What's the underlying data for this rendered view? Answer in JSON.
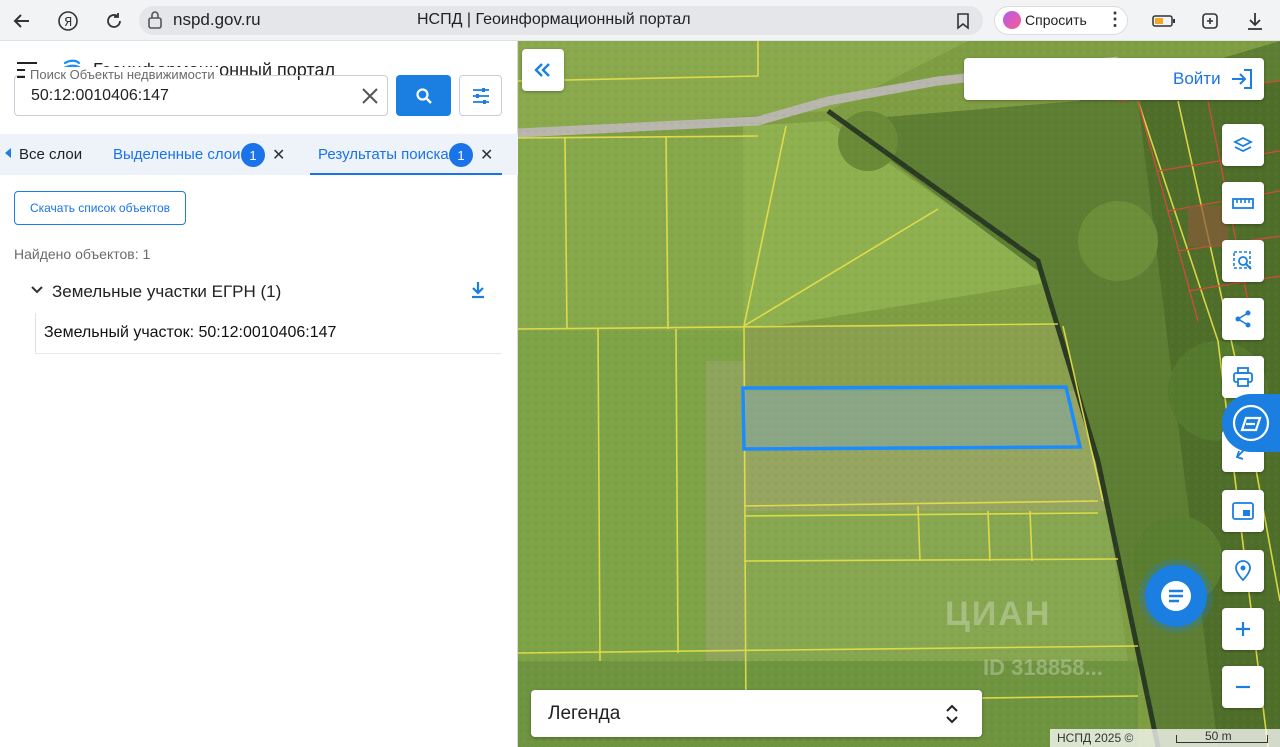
{
  "browser": {
    "url": "nspd.gov.ru",
    "page_title": "НСПД | Геоинформационный портал",
    "ask_label": "Спросить"
  },
  "panel": {
    "portal_title": "Геоинформационный портал",
    "search": {
      "label": "Поиск Объекты недвижимости",
      "value": "50:12:0010406:147"
    },
    "tabs": [
      {
        "label": "Все слои"
      },
      {
        "label": "Выделенные слои",
        "badge": "1"
      },
      {
        "label": "Результаты поиска",
        "badge": "1",
        "active": true
      }
    ],
    "download_list_label": "Скачать список объектов",
    "found_count": "Найдено объектов: 1",
    "group_title": "Земельные участки ЕГРН (1)",
    "results": [
      {
        "label": "Земельный участок: 50:12:0010406:147"
      }
    ]
  },
  "map": {
    "login_label": "Войти",
    "legend_label": "Легенда",
    "attribution": "НСПД 2025 ©",
    "scale_label": "50 m",
    "watermark": "ЦИАН",
    "watermark_id": "ID 318858..."
  },
  "colors": {
    "accent": "#1a7fe0",
    "link": "#1a73e8",
    "parcel_line": "#e8e04a",
    "selected_parcel": "#1a8cff"
  }
}
